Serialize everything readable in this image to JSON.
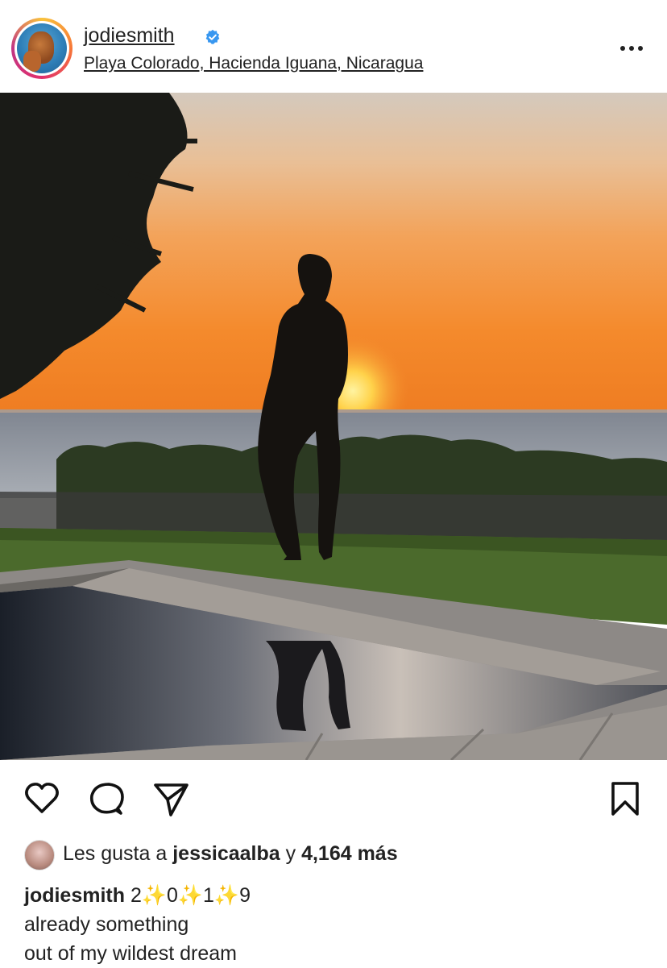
{
  "post": {
    "username": "jodiesmith",
    "verified_icon": "verified-badge-icon",
    "location": "Playa Colorado, Hacienda Iguana, Nicaragua",
    "more_icon": "more-options-icon"
  },
  "photo": {
    "icon": "sunset-silhouette-photo"
  },
  "actions": {
    "like_icon": "heart-icon",
    "comment_icon": "comment-icon",
    "share_icon": "send-icon",
    "save_icon": "bookmark-icon"
  },
  "likes": {
    "prefix": "Les gusta a",
    "user": "jessicaalba",
    "connector": "y",
    "count": "4,164 más"
  },
  "caption": {
    "user": "jodiesmith",
    "title": "2✨0✨1✨9",
    "line1": "already something",
    "line2": "out of my wildest dream"
  },
  "colors": {
    "verified": "#3897f0",
    "sky_top": "#d3c6b6",
    "sky_horizon": "#f0842a",
    "sun": "#ffd24a",
    "sea": "#8c93a0"
  }
}
